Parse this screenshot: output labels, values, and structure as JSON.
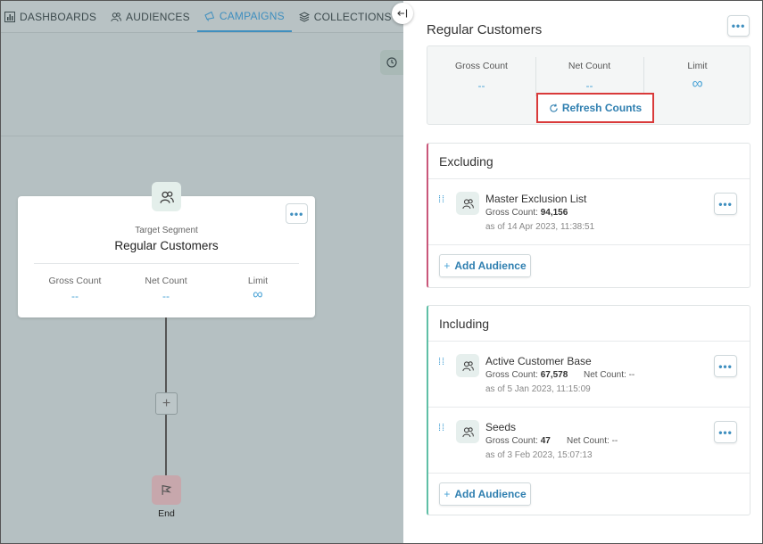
{
  "nav": {
    "items": [
      {
        "label": "DASHBOARDS",
        "icon": "dashboard-icon"
      },
      {
        "label": "AUDIENCES",
        "icon": "users-icon"
      },
      {
        "label": "CAMPAIGNS",
        "icon": "megaphone-icon",
        "active": true
      },
      {
        "label": "COLLECTIONS",
        "icon": "layers-icon"
      }
    ]
  },
  "canvas": {
    "segment_card": {
      "subtitle": "Target Segment",
      "title": "Regular Customers",
      "gross_label": "Gross Count",
      "gross_value": "--",
      "net_label": "Net Count",
      "net_value": "--",
      "limit_label": "Limit",
      "limit_value": "∞"
    },
    "add_step": "+",
    "end_label": "End"
  },
  "panel": {
    "title": "Regular Customers",
    "more": "•••",
    "stats": {
      "gross_label": "Gross Count",
      "gross_value": "--",
      "net_label": "Net Count",
      "net_value": "--",
      "limit_label": "Limit",
      "limit_value": "∞"
    },
    "refresh_label": "Refresh Counts",
    "excluding": {
      "heading": "Excluding",
      "audiences": [
        {
          "name": "Master Exclusion List",
          "gross": "Gross Count:",
          "gross_value": "94,156",
          "net": "",
          "date": "as of 14 Apr 2023, 11:38:51"
        }
      ],
      "add_label": "Add Audience"
    },
    "including": {
      "heading": "Including",
      "audiences": [
        {
          "name": "Active Customer Base",
          "gross": "Gross Count:",
          "gross_value": "67,578",
          "net": "Net Count: --",
          "date": "as of 5 Jan 2023, 11:15:09"
        },
        {
          "name": "Seeds",
          "gross": "Gross Count:",
          "gross_value": "47",
          "net": "Net Count: --",
          "date": "as of 3 Feb 2023, 15:07:13"
        }
      ],
      "add_label": "Add Audience"
    }
  },
  "colors": {
    "accent": "#3f8fbf",
    "exclude_border": "#c9577a",
    "include_border": "#5fbfa6",
    "highlight": "#d93a3a"
  }
}
